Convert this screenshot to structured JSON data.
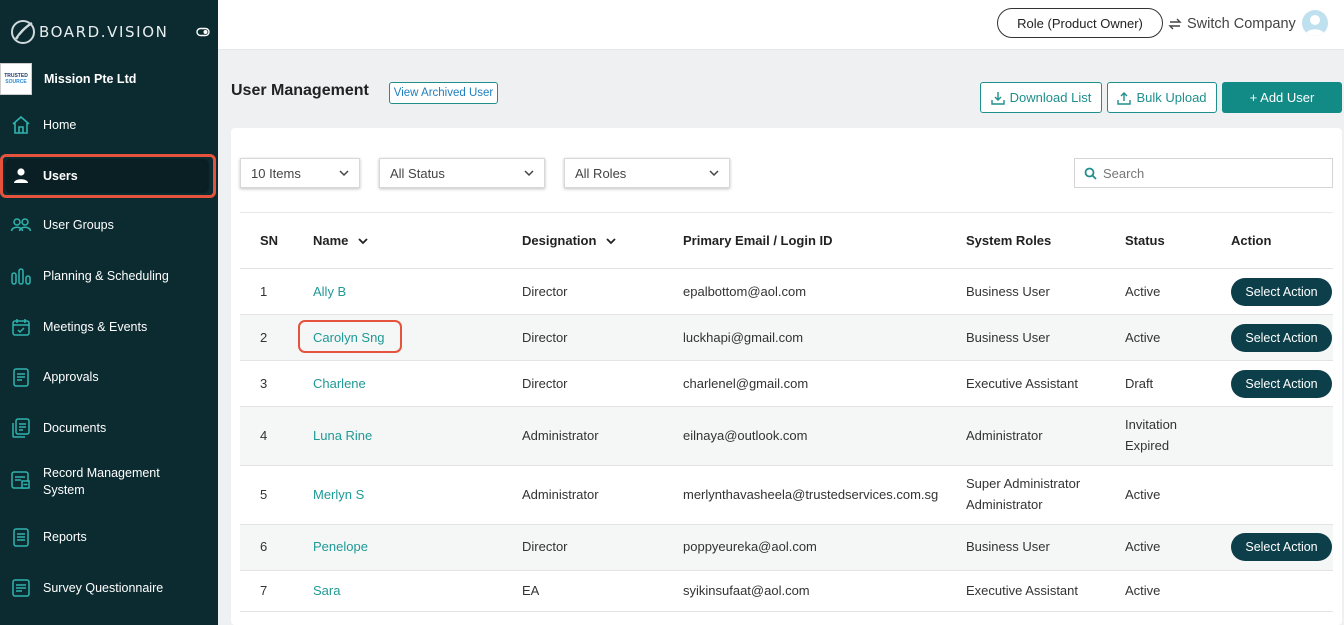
{
  "brand": {
    "name": "BOARD.VISION"
  },
  "org": {
    "logo_line1": "TRUSTED",
    "logo_line2": "SOURCE",
    "name": "Mission Pte Ltd"
  },
  "nav": [
    {
      "label": "Home",
      "icon": "home-icon"
    },
    {
      "label": "Users",
      "icon": "user-icon",
      "active": true
    },
    {
      "label": "User Groups",
      "icon": "users-icon"
    },
    {
      "label": "Planning & Scheduling",
      "icon": "chart-icon"
    },
    {
      "label": "Meetings & Events",
      "icon": "calendar-icon"
    },
    {
      "label": "Approvals",
      "icon": "document-icon"
    },
    {
      "label": "Documents",
      "icon": "documents-icon"
    },
    {
      "label": "Record Management\nSystem",
      "icon": "record-icon"
    },
    {
      "label": "Reports",
      "icon": "report-icon"
    },
    {
      "label": "Survey Questionnaire",
      "icon": "survey-icon"
    }
  ],
  "topbar": {
    "role": "Role (Product Owner)",
    "switch_company": "Switch Company"
  },
  "page": {
    "title": "User Management",
    "view_archived": "View Archived User",
    "download": "Download List",
    "bulk_upload": "Bulk Upload",
    "add_user": "+ Add User"
  },
  "filters": {
    "items": "10 Items",
    "status": "All Status",
    "roles": "All Roles",
    "search_placeholder": "Search"
  },
  "table": {
    "headers": {
      "sn": "SN",
      "name": "Name",
      "designation": "Designation",
      "email": "Primary Email / Login ID",
      "roles": "System Roles",
      "status": "Status",
      "action": "Action"
    },
    "action_label": "Select Action",
    "rows": [
      {
        "sn": "1",
        "name": "Ally B",
        "designation": "Director",
        "email": "epalbottom@aol.com",
        "roles": "Business User",
        "status": "Active",
        "action": true
      },
      {
        "sn": "2",
        "name": "Carolyn Sng",
        "designation": "Director",
        "email": "luckhapi@gmail.com",
        "roles": "Business User",
        "status": "Active",
        "action": true
      },
      {
        "sn": "3",
        "name": "Charlene",
        "designation": "Director",
        "email": "charlenel@gmail.com",
        "roles": "Executive Assistant",
        "status": "Draft",
        "action": true
      },
      {
        "sn": "4",
        "name": "Luna Rine",
        "designation": "Administrator",
        "email": "eilnaya@outlook.com",
        "roles": "Administrator",
        "status": "Invitation\nExpired",
        "action": false
      },
      {
        "sn": "5",
        "name": "Merlyn S",
        "designation": "Administrator",
        "email": "merlynthavasheela@trustedservices.com.sg",
        "roles": "Super Administrator\nAdministrator",
        "status": "Active",
        "action": false
      },
      {
        "sn": "6",
        "name": "Penelope",
        "designation": "Director",
        "email": "poppyeureka@aol.com",
        "roles": "Business User",
        "status": "Active",
        "action": true
      },
      {
        "sn": "7",
        "name": "Sara",
        "designation": "EA",
        "email": "syikinsufaat@aol.com",
        "roles": "Executive Assistant",
        "status": "Active",
        "action": false
      }
    ]
  },
  "colors": {
    "sidebar": "#0c2b30",
    "accent": "#1f8f8c",
    "action": "#0d3f4a",
    "highlight": "#e5533d"
  }
}
